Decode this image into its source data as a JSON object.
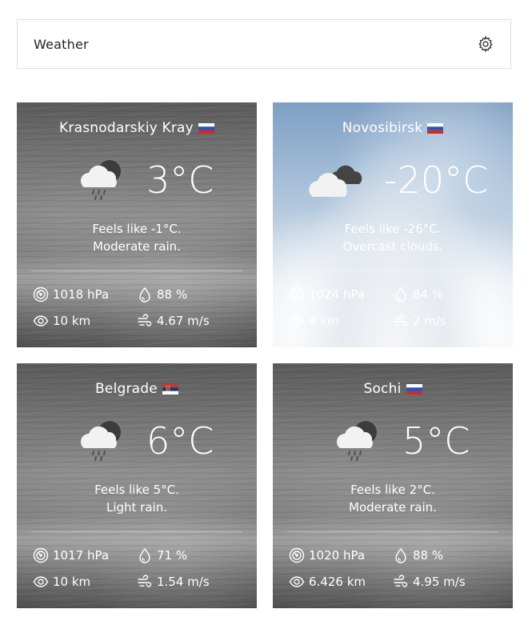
{
  "header": {
    "title": "Weather"
  },
  "cards": [
    {
      "city": "Krasnodarskiy Kray",
      "flag": "ru",
      "temp": "3°C",
      "feels": "Feels like -1°C.",
      "condition": "Moderate rain.",
      "pressure": "1018 hPa",
      "humidity": "88 %",
      "visibility": "10 km",
      "wind": "4.67 m/s",
      "icon": "cloud-rain-icon",
      "background": "rain"
    },
    {
      "city": "Novosibirsk",
      "flag": "ru",
      "temp": "-20°C",
      "feels": "Feels like -26°C.",
      "condition": "Overcast clouds.",
      "pressure": "1024 hPa",
      "humidity": "84 %",
      "visibility": "8 km",
      "wind": "2 m/s",
      "icon": "overcast-clouds-icon",
      "background": "clouds"
    },
    {
      "city": "Belgrade",
      "flag": "rs",
      "temp": "6°C",
      "feels": "Feels like 5°C.",
      "condition": "Light rain.",
      "pressure": "1017 hPa",
      "humidity": "71 %",
      "visibility": "10 km",
      "wind": "1.54 m/s",
      "icon": "cloud-rain-icon",
      "background": "rain"
    },
    {
      "city": "Sochi",
      "flag": "ru",
      "temp": "5°C",
      "feels": "Feels like 2°C.",
      "condition": "Moderate rain.",
      "pressure": "1020 hPa",
      "humidity": "88 %",
      "visibility": "6.426 km",
      "wind": "4.95 m/s",
      "icon": "cloud-rain-icon",
      "background": "rain"
    }
  ]
}
